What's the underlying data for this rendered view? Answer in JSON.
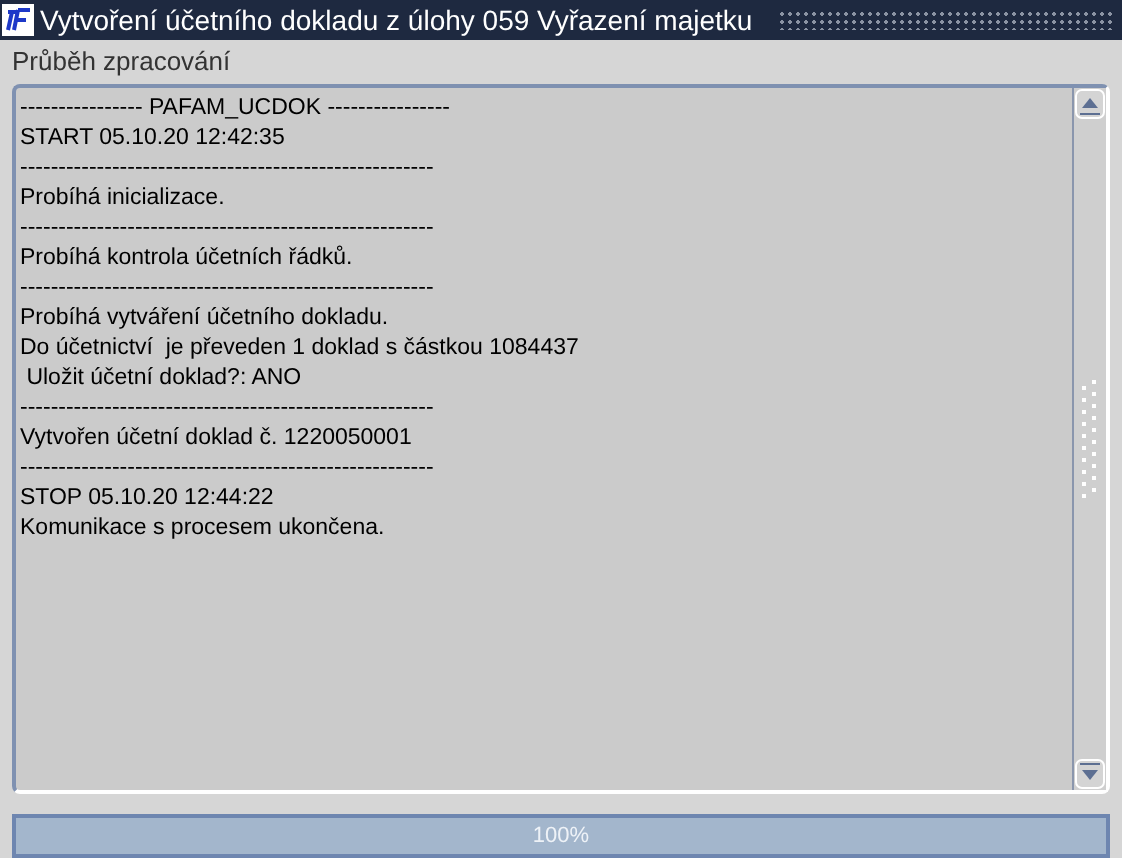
{
  "window": {
    "title": "Vytvoření účetního dokladu z úlohy 059 Vyřazení majetku"
  },
  "section_label": "Průběh zpracování",
  "log_lines": [
    "---------------- PAFAM_UCDOK ----------------",
    "START 05.10.20 12:42:35",
    "------------------------------------------------------",
    "Probíhá inicializace.",
    "------------------------------------------------------",
    "Probíhá kontrola účetních řádků.",
    "------------------------------------------------------",
    "Probíhá vytváření účetního dokladu.",
    "Do účetnictví  je převeden 1 doklad s částkou 1084437",
    " Uložit účetní doklad?: ANO",
    "------------------------------------------------------",
    "Vytvořen účetní doklad č. 1220050001",
    "------------------------------------------------------",
    "STOP 05.10.20 12:44:22",
    "Komunikace s procesem ukončena."
  ],
  "progress": {
    "level": 1,
    "reading": "100%"
  }
}
